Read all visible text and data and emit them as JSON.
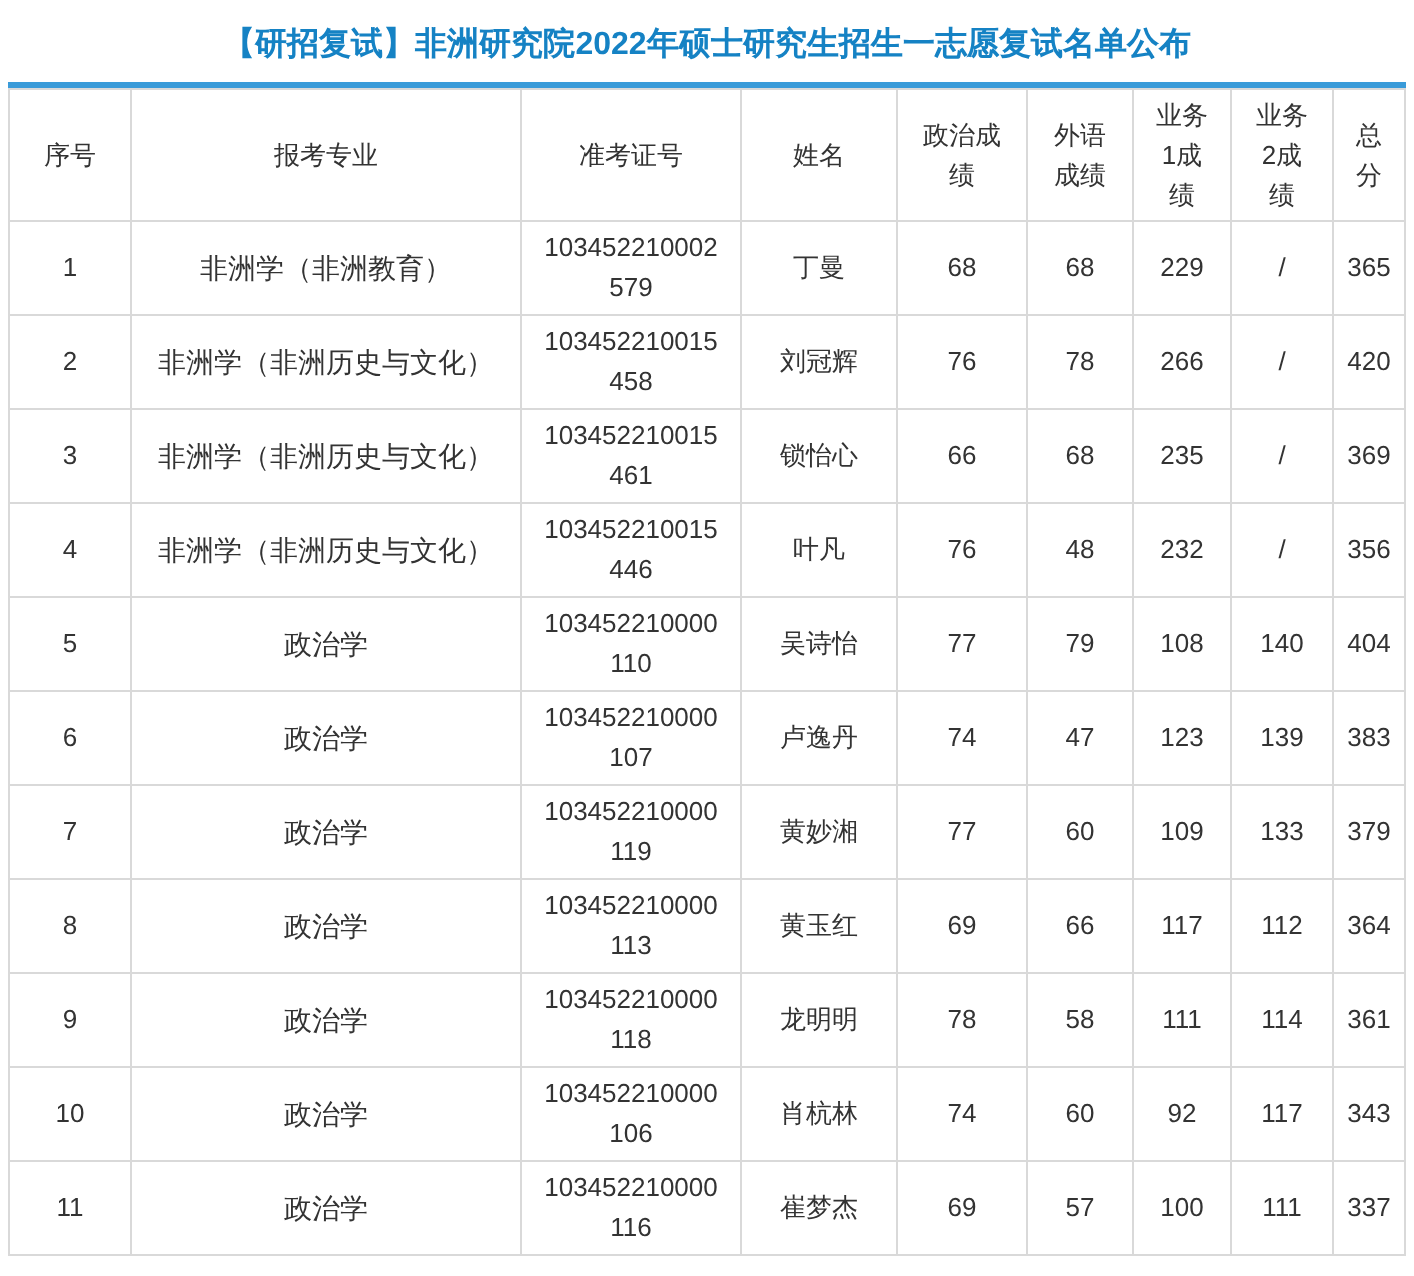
{
  "title": "【研招复试】非洲研究院2022年硕士研究生招生一志愿复试名单公布",
  "table": {
    "columns": [
      "序号",
      "报考专业",
      "准考证号",
      "姓名",
      "政治成绩",
      "外语成绩",
      "业务1成绩",
      "业务2成绩",
      "总分"
    ],
    "rows": [
      [
        "1",
        "非洲学（非洲教育）",
        "103452210002579",
        "丁曼",
        "68",
        "68",
        "229",
        "/",
        "365"
      ],
      [
        "2",
        "非洲学（非洲历史与文化）",
        "103452210015458",
        "刘冠辉",
        "76",
        "78",
        "266",
        "/",
        "420"
      ],
      [
        "3",
        "非洲学（非洲历史与文化）",
        "103452210015461",
        "锁怡心",
        "66",
        "68",
        "235",
        "/",
        "369"
      ],
      [
        "4",
        "非洲学（非洲历史与文化）",
        "103452210015446",
        "叶凡",
        "76",
        "48",
        "232",
        "/",
        "356"
      ],
      [
        "5",
        "政治学",
        "103452210000110",
        "吴诗怡",
        "77",
        "79",
        "108",
        "140",
        "404"
      ],
      [
        "6",
        "政治学",
        "103452210000107",
        "卢逸丹",
        "74",
        "47",
        "123",
        "139",
        "383"
      ],
      [
        "7",
        "政治学",
        "103452210000119",
        "黄妙湘",
        "77",
        "60",
        "109",
        "133",
        "379"
      ],
      [
        "8",
        "政治学",
        "103452210000113",
        "黄玉红",
        "69",
        "66",
        "117",
        "112",
        "364"
      ],
      [
        "9",
        "政治学",
        "103452210000118",
        "龙明明",
        "78",
        "58",
        "111",
        "114",
        "361"
      ],
      [
        "10",
        "政治学",
        "103452210000106",
        "肖杭林",
        "74",
        "60",
        "92",
        "117",
        "343"
      ],
      [
        "11",
        "政治学",
        "103452210000116",
        "崔梦杰",
        "69",
        "57",
        "100",
        "111",
        "337"
      ]
    ]
  }
}
